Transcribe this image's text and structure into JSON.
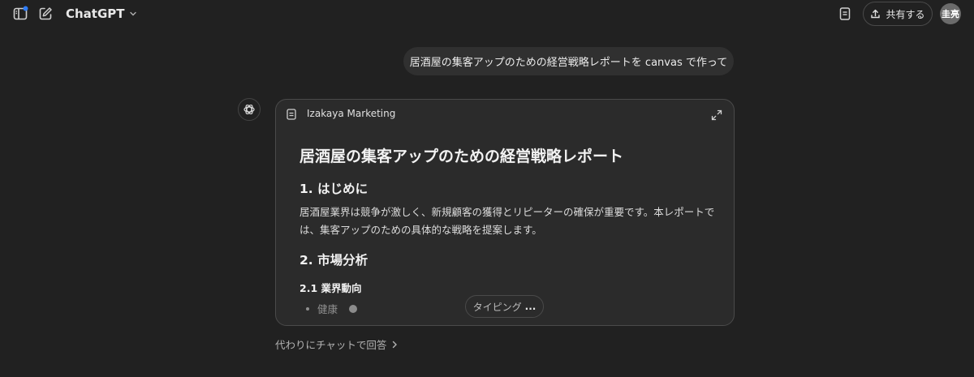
{
  "header": {
    "model_name": "ChatGPT",
    "share_label": "共有する",
    "avatar_initials": "圭亮",
    "icons": {
      "sidebar": "sidebar-toggle-icon",
      "new_chat": "new-chat-icon",
      "model_dropdown": "chevron-down-icon",
      "canvas_doc": "document-icon",
      "share": "share-upload-icon"
    },
    "notification_dot_color": "#2f7cf6"
  },
  "conversation": {
    "user_message": "居酒屋の集客アップのための経営戦略レポートを canvas で作って",
    "assistant_icon": "openai-logo-icon"
  },
  "canvas": {
    "title": "Izakaya Marketing",
    "document": {
      "h1": "居酒屋の集客アップのための経営戦略レポート",
      "section1_heading": "1. はじめに",
      "section1_paragraph": "居酒屋業界は競争が激しく、新規顧客の獲得とリピーターの確保が重要です。本レポートでは、集客アップのための具体的な戦略を提案します。",
      "section2_heading": "2. 市場分析",
      "subsection_heading": "2.1 業界動向",
      "list_item": "健康"
    },
    "typing_status": "タイピング",
    "typing_dots": "..."
  },
  "footer": {
    "chat_instead_label": "代わりにチャットで回答"
  }
}
